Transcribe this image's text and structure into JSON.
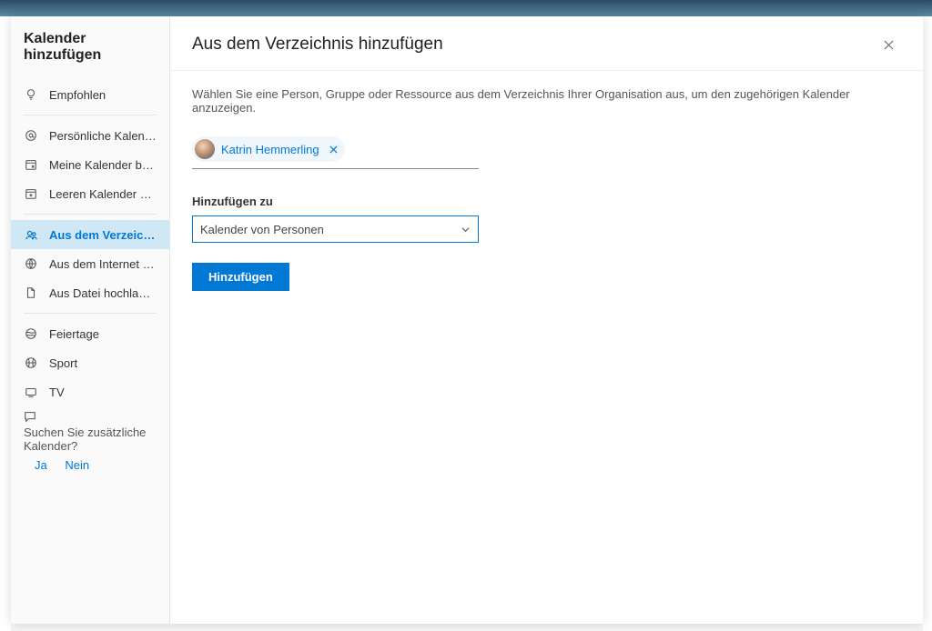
{
  "sidebar": {
    "title": "Kalender hinzufügen",
    "items": [
      {
        "label": "Empfohlen",
        "icon": "lightbulb"
      },
      {
        "label": "Persönliche Kalender hi…",
        "icon": "at"
      },
      {
        "label": "Meine Kalender bearbei…",
        "icon": "edit-cal"
      },
      {
        "label": "Leeren Kalender erstellen",
        "icon": "plus-cal"
      },
      {
        "label": "Aus dem Verzeichnis hi…",
        "icon": "people",
        "active": true
      },
      {
        "label": "Aus dem Internet abon…",
        "icon": "globe"
      },
      {
        "label": "Aus Datei hochladen",
        "icon": "file"
      },
      {
        "label": "Feiertage",
        "icon": "world"
      },
      {
        "label": "Sport",
        "icon": "sport"
      },
      {
        "label": "TV",
        "icon": "tv"
      }
    ],
    "prompt": {
      "text": "Suchen Sie zusätzliche Kalender?",
      "yes": "Ja",
      "no": "Nein"
    }
  },
  "main": {
    "title": "Aus dem Verzeichnis hinzufügen",
    "description": "Wählen Sie eine Person, Gruppe oder Ressource aus dem Verzeichnis Ihrer Organisation aus, um den zugehörigen Kalender anzuzeigen.",
    "person": {
      "name": "Katrin Hemmerling"
    },
    "addToLabel": "Hinzufügen zu",
    "select": {
      "value": "Kalender von Personen"
    },
    "addButton": "Hinzufügen"
  }
}
